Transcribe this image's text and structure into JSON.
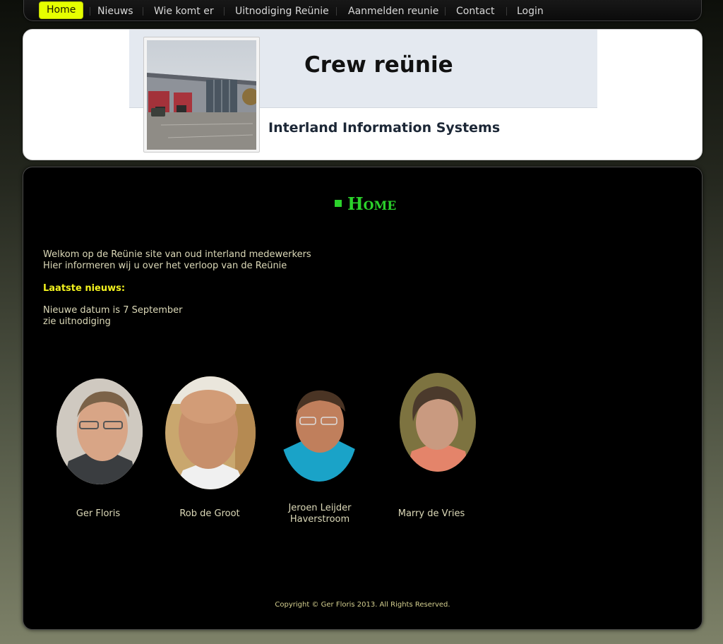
{
  "nav": {
    "items": [
      {
        "label": "Home",
        "active": true
      },
      {
        "label": "Nieuws"
      },
      {
        "label": "Wie komt er"
      },
      {
        "label": "Uitnodiging Reünie"
      },
      {
        "label": "Aanmelden reunie"
      },
      {
        "label": "Contact"
      },
      {
        "label": "Login"
      }
    ],
    "active_color": "#e6ff00"
  },
  "header": {
    "title": "Crew reünie",
    "subtitle": "Interland Information Systems"
  },
  "main": {
    "heading": "Home",
    "heading_color": "#2bd22b",
    "intro_lines": [
      "Welkom op de Reünie site van oud interland medewerkers",
      "Hier informeren wij u over het verloop van de Reünie"
    ],
    "news_heading": "Laatste nieuws:",
    "news_heading_color": "#f2f21e",
    "news_lines": [
      "Nieuwe datum is 7 September",
      "zie uitnodiging"
    ],
    "people": [
      {
        "name_lines": [
          "Ger Floris"
        ]
      },
      {
        "name_lines": [
          "Rob de Groot"
        ]
      },
      {
        "name_lines": [
          "Jeroen Leijder",
          "Haverstroom"
        ]
      },
      {
        "name_lines": [
          "Marry de Vries"
        ]
      }
    ]
  },
  "footer": {
    "copyright": "Copyright © Ger Floris 2013. All Rights Reserved."
  }
}
